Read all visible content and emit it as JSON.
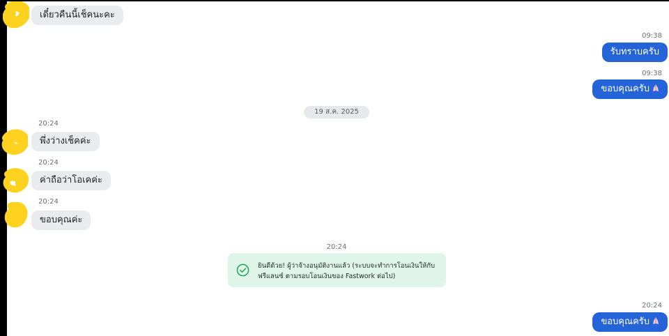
{
  "colors": {
    "incoming_bubble": "#e9ebee",
    "outgoing_bubble": "#2563d8",
    "system_card": "#dff5e9",
    "system_icon": "#22a35a",
    "avatar_scribble": "#ffd21f"
  },
  "messages": [
    {
      "id": "m1",
      "side": "left",
      "text": "เดี๋ยวคืนนี้เช็คนะคะ",
      "avatar": "redacted-avatar"
    },
    {
      "id": "m2",
      "side": "right",
      "time": "09:38",
      "text": "รับทราบครับ"
    },
    {
      "id": "m3",
      "side": "right",
      "time": "09:38",
      "text": "ขอบคุณครับ",
      "emoji": "praying-hands-icon"
    },
    {
      "id": "m4",
      "side": "left",
      "time": "20:24",
      "text": "พึ่งว่างเช็คค่ะ",
      "avatar": "redacted-avatar"
    },
    {
      "id": "m5",
      "side": "left",
      "time": "20:24",
      "text": "ค่าถือว่าโอเคค่ะ",
      "avatar": "redacted-avatar"
    },
    {
      "id": "m6",
      "side": "left",
      "time": "20:24",
      "text": "ขอบคุณค่ะ",
      "avatar": "redacted-avatar"
    },
    {
      "id": "m7",
      "side": "right",
      "time": "20:24",
      "text": "ขอบคุณครับ",
      "emoji": "praying-hands-icon"
    }
  ],
  "date_separator": "19 ส.ค. 2025",
  "system_message": {
    "time": "20:24",
    "icon": "check-circle-icon",
    "line1": "ยินดีด้วย! ผู้ว่าจ้างอนุมัติงานแล้ว (ระบบจะทำการโอนเงินให้กับ",
    "line2": "ฟรีแลนซ์ ตามรอบโอนเงินของ Fastwork ต่อไป)"
  }
}
